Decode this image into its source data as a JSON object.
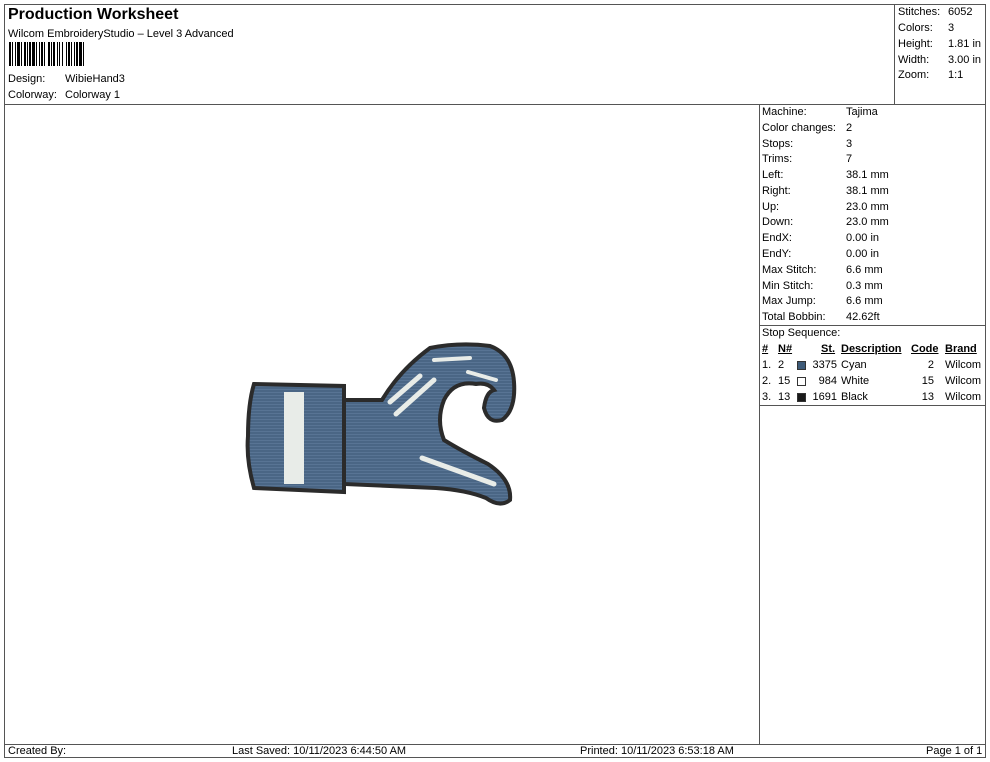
{
  "header": {
    "title": "Production Worksheet",
    "subtitle": "Wilcom EmbroideryStudio – Level 3 Advanced",
    "design_label": "Design:",
    "design_value": "WibieHand3",
    "colorway_label": "Colorway:",
    "colorway_value": "Colorway 1"
  },
  "summary": {
    "stitches_label": "Stitches:",
    "stitches_value": "6052",
    "colors_label": "Colors:",
    "colors_value": "3",
    "height_label": "Height:",
    "height_value": "1.81 in",
    "width_label": "Width:",
    "width_value": "3.00 in",
    "zoom_label": "Zoom:",
    "zoom_value": "1:1"
  },
  "stats": [
    {
      "label": "Machine:",
      "value": "Tajima"
    },
    {
      "label": "Color changes:",
      "value": "2"
    },
    {
      "label": "Stops:",
      "value": "3"
    },
    {
      "label": "Trims:",
      "value": "7"
    },
    {
      "label": "Left:",
      "value": "38.1 mm"
    },
    {
      "label": "Right:",
      "value": "38.1 mm"
    },
    {
      "label": "Up:",
      "value": "23.0 mm"
    },
    {
      "label": "Down:",
      "value": "23.0 mm"
    },
    {
      "label": "EndX:",
      "value": "0.00 in"
    },
    {
      "label": "EndY:",
      "value": "0.00 in"
    },
    {
      "label": "Max Stitch:",
      "value": "6.6 mm"
    },
    {
      "label": "Min Stitch:",
      "value": "0.3 mm"
    },
    {
      "label": "Max Jump:",
      "value": "6.6 mm"
    },
    {
      "label": "Total Bobbin:",
      "value": "42.62ft"
    }
  ],
  "stop_sequence": {
    "label": "Stop Sequence:",
    "headers": {
      "num": "#",
      "n": "N#",
      "st": "St.",
      "desc": "Description",
      "code": "Code",
      "brand": "Brand"
    },
    "rows": [
      {
        "num": "1.",
        "n": "2",
        "color": "#3d5a78",
        "st": "3375",
        "desc": "Cyan",
        "code": "2",
        "brand": "Wilcom"
      },
      {
        "num": "2.",
        "n": "15",
        "color": "#ffffff",
        "st": "984",
        "desc": "White",
        "code": "15",
        "brand": "Wilcom"
      },
      {
        "num": "3.",
        "n": "13",
        "color": "#1a1a1a",
        "st": "1691",
        "desc": "Black",
        "code": "13",
        "brand": "Wilcom"
      }
    ]
  },
  "footer": {
    "created_by": "Created By:",
    "last_saved": "Last Saved: 10/11/2023 6:44:50 AM",
    "printed": "Printed: 10/11/2023 6:53:18 AM",
    "page": "Page 1 of 1"
  },
  "colors": {
    "fabric_blue": "#4a6685",
    "outline": "#2b2b2b",
    "highlight": "#e8ece8"
  }
}
